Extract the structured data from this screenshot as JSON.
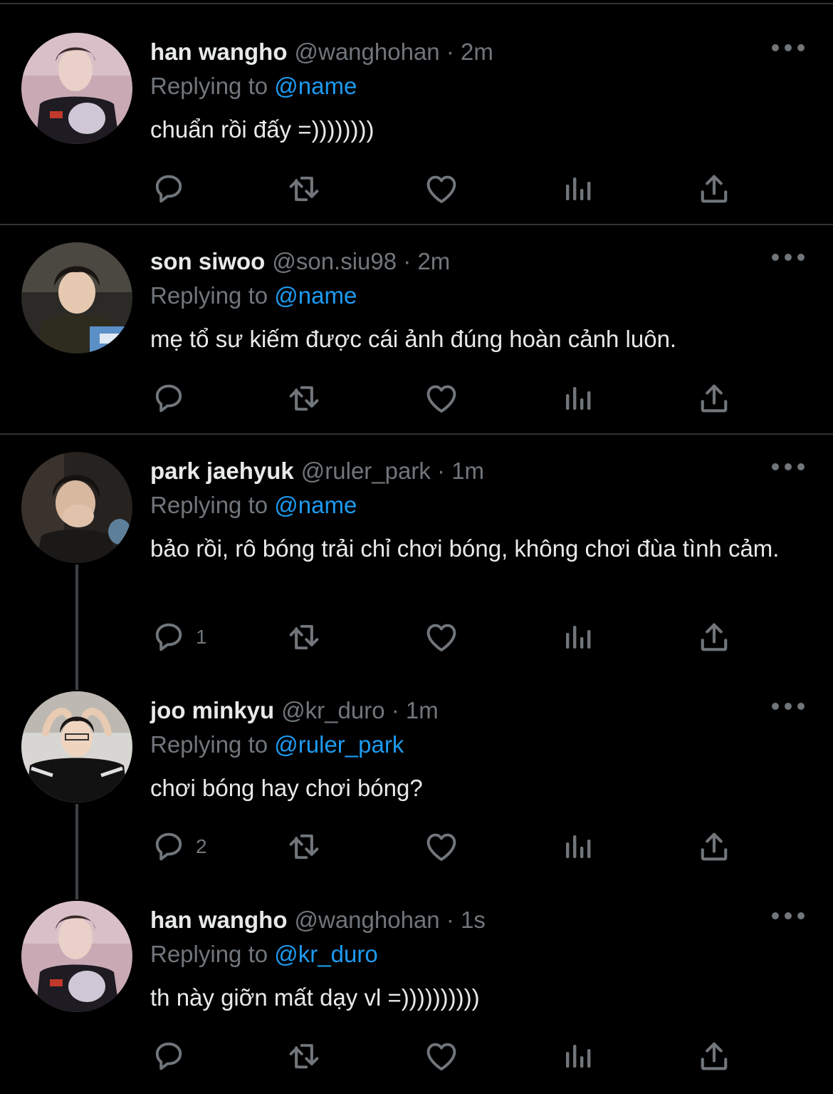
{
  "colors": {
    "background": "#000000",
    "text_primary": "#e7e9ea",
    "text_secondary": "#71767b",
    "mention": "#1d9bf0",
    "divider": "#2f3336"
  },
  "icons": {
    "reply": "speech-bubble-icon",
    "retweet": "retweet-arrows-icon",
    "like": "heart-icon",
    "views": "bar-chart-icon",
    "share": "upload-arrow-icon",
    "more": "three-dots-icon"
  },
  "tweets": [
    {
      "name": "han wangho",
      "handle": "@wanghohan",
      "separator": "·",
      "time": "2m",
      "replying_prefix": "Replying to",
      "replying_to": "@name",
      "text": "chuẩn rồi đấy =))))))))",
      "reply_count": ""
    },
    {
      "name": "son siwoo",
      "handle": "@son.siu98",
      "separator": "·",
      "time": "2m",
      "replying_prefix": "Replying to",
      "replying_to": "@name",
      "text": "mẹ tổ sư kiếm được cái ảnh đúng hoàn cảnh luôn.",
      "reply_count": ""
    },
    {
      "name": "park jaehyuk",
      "handle": "@ruler_park",
      "separator": "·",
      "time": "1m",
      "replying_prefix": "Replying to",
      "replying_to": "@name",
      "text": "bảo rồi, rô bóng trải chỉ chơi bóng, không chơi đùa tình cảm.",
      "reply_count": "1"
    },
    {
      "name": "joo minkyu",
      "handle": "@kr_duro",
      "separator": "·",
      "time": "1m",
      "replying_prefix": "Replying to",
      "replying_to": "@ruler_park",
      "text": "chơi bóng hay chơi bóng?",
      "reply_count": "2"
    },
    {
      "name": "han wangho",
      "handle": "@wanghohan",
      "separator": "·",
      "time": "1s",
      "replying_prefix": "Replying to",
      "replying_to": "@kr_duro",
      "text": "th này giỡn mất dạy vl =))))))))))",
      "reply_count": ""
    }
  ]
}
